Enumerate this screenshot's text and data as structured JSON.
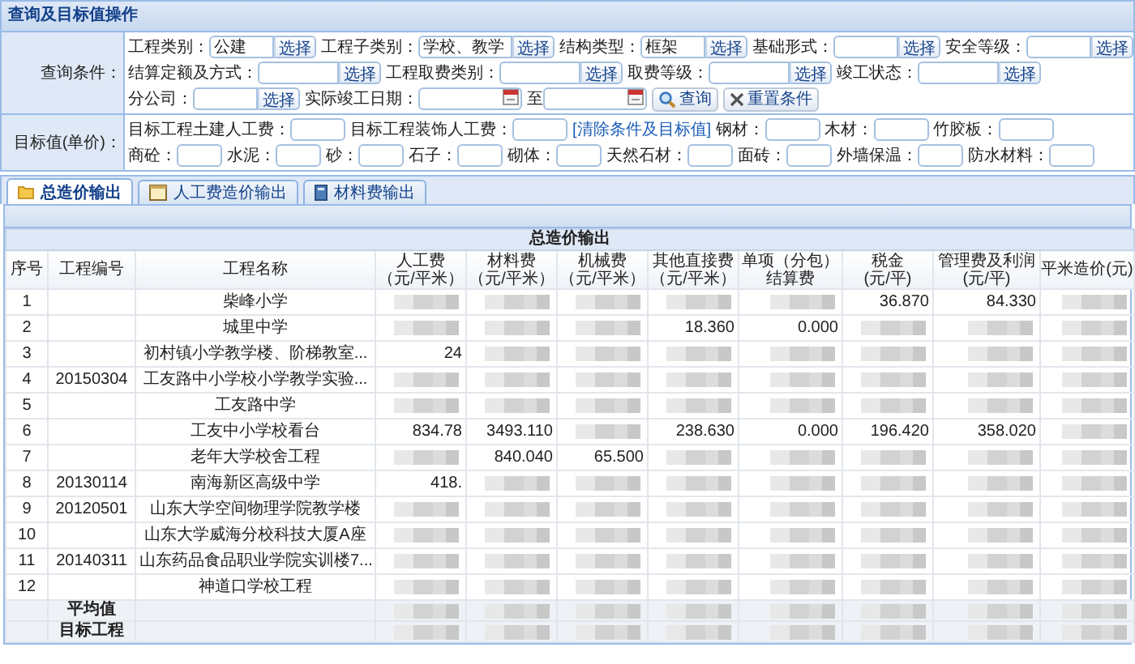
{
  "panel": {
    "title": "查询及目标值操作"
  },
  "query": {
    "label": "查询条件：",
    "rows": [
      {
        "fields": [
          {
            "kind": "select",
            "label": "工程类别：",
            "value": "公建",
            "button": "选择"
          },
          {
            "kind": "select",
            "label": "工程子类别：",
            "value": "学校、教学",
            "button": "选择"
          },
          {
            "kind": "select",
            "label": "结构类型：",
            "value": "框架",
            "button": "选择"
          },
          {
            "kind": "select",
            "label": "基础形式：",
            "button": "选择"
          },
          {
            "kind": "select",
            "label": "安全等级：",
            "button": "选择"
          }
        ]
      },
      {
        "fields": [
          {
            "kind": "select",
            "label": "结算定额及方式：",
            "button": "选择"
          },
          {
            "kind": "select",
            "label": "工程取费类别：",
            "button": "选择"
          },
          {
            "kind": "select",
            "label": "取费等级：",
            "button": "选择"
          },
          {
            "kind": "select",
            "label": "竣工状态：",
            "button": "选择"
          }
        ]
      },
      {
        "fields": [
          {
            "kind": "select",
            "label": "分公司：",
            "button": "选择"
          },
          {
            "kind": "date",
            "label": "实际竣工日期："
          },
          {
            "kind": "date",
            "label": "至"
          },
          {
            "kind": "search",
            "button": "查询"
          },
          {
            "kind": "reset",
            "button": "重置条件"
          }
        ]
      }
    ]
  },
  "targets": {
    "label": "目标值(单价)：",
    "rows": [
      {
        "fields": [
          {
            "kind": "text",
            "label": "目标工程土建人工费："
          },
          {
            "kind": "text",
            "label": "目标工程装饰人工费："
          },
          {
            "kind": "link",
            "button": "[清除条件及目标值]"
          },
          {
            "kind": "text",
            "label": "钢材："
          },
          {
            "kind": "text",
            "label": "木材："
          },
          {
            "kind": "text",
            "label": "竹胶板："
          }
        ]
      },
      {
        "fields": [
          {
            "kind": "text",
            "label": "商砼："
          },
          {
            "kind": "text",
            "label": "水泥："
          },
          {
            "kind": "text",
            "label": "砂："
          },
          {
            "kind": "text",
            "label": "石子："
          },
          {
            "kind": "text",
            "label": "砌体："
          },
          {
            "kind": "text",
            "label": "天然石材："
          },
          {
            "kind": "text",
            "label": "面砖："
          },
          {
            "kind": "text",
            "label": "外墙保温："
          },
          {
            "kind": "text",
            "label": "防水材料："
          }
        ]
      }
    ]
  },
  "tabs": [
    {
      "label": "总造价输出",
      "selected": true
    },
    {
      "label": "人工费造价输出",
      "selected": false
    },
    {
      "label": "材料费输出",
      "selected": false
    }
  ],
  "table": {
    "caption": "总造价输出",
    "columns": [
      {
        "lines": [
          "序号"
        ]
      },
      {
        "lines": [
          "工程编号"
        ]
      },
      {
        "lines": [
          "工程名称"
        ]
      },
      {
        "lines": [
          "人工费",
          "（元/平米）"
        ]
      },
      {
        "lines": [
          "材料费",
          "（元/平米）"
        ]
      },
      {
        "lines": [
          "机械费",
          "（元/平米）"
        ]
      },
      {
        "lines": [
          "其他直接费",
          "（元/平米）"
        ]
      },
      {
        "lines": [
          "单项（分包）",
          "结算费"
        ]
      },
      {
        "lines": [
          "税金",
          "(元/平)"
        ]
      },
      {
        "lines": [
          "管理费及利润",
          "(元/平)"
        ]
      },
      {
        "lines": [
          "平米造价(元)"
        ]
      }
    ],
    "rows": [
      {
        "cells": [
          {
            "text": "1"
          },
          {
            "text": ""
          },
          {
            "text": "柴峰小学"
          },
          {
            "blurred": true
          },
          {
            "blurred": true
          },
          {
            "blurred": true
          },
          {
            "blurred": true
          },
          {
            "blurred": true
          },
          {
            "text": "36.870"
          },
          {
            "text": "84.330"
          },
          {
            "blurred": true
          }
        ]
      },
      {
        "cells": [
          {
            "text": "2"
          },
          {
            "text": ""
          },
          {
            "text": "城里中学"
          },
          {
            "blurred": true
          },
          {
            "blurred": true
          },
          {
            "blurred": true
          },
          {
            "text": "18.360"
          },
          {
            "text": "0.000"
          },
          {
            "blurred": true
          },
          {
            "blurred": true
          },
          {
            "blurred": true
          }
        ]
      },
      {
        "cells": [
          {
            "text": "3"
          },
          {
            "text": ""
          },
          {
            "text": "初村镇小学教学楼、阶梯教室..."
          },
          {
            "text": "24"
          },
          {
            "blurred": true
          },
          {
            "blurred": true
          },
          {
            "blurred": true
          },
          {
            "blurred": true
          },
          {
            "blurred": true
          },
          {
            "blurred": true
          },
          {
            "blurred": true
          }
        ]
      },
      {
        "cells": [
          {
            "text": "4"
          },
          {
            "text": "20150304"
          },
          {
            "text": "工友路中小学校小学教学实验..."
          },
          {
            "blurred": true
          },
          {
            "blurred": true
          },
          {
            "blurred": true
          },
          {
            "blurred": true
          },
          {
            "blurred": true
          },
          {
            "blurred": true
          },
          {
            "blurred": true
          },
          {
            "blurred": true
          }
        ]
      },
      {
        "cells": [
          {
            "text": "5"
          },
          {
            "text": ""
          },
          {
            "text": "工友路中学"
          },
          {
            "blurred": true
          },
          {
            "blurred": true
          },
          {
            "blurred": true
          },
          {
            "blurred": true
          },
          {
            "blurred": true
          },
          {
            "blurred": true
          },
          {
            "blurred": true
          },
          {
            "blurred": true
          }
        ]
      },
      {
        "cells": [
          {
            "text": "6"
          },
          {
            "text": ""
          },
          {
            "text": "工友中小学校看台"
          },
          {
            "text": "834.78"
          },
          {
            "text": "3493.110"
          },
          {
            "blurred": true
          },
          {
            "text": "238.630"
          },
          {
            "text": "0.000"
          },
          {
            "text": "196.420"
          },
          {
            "text": "358.020"
          },
          {
            "blurred": true
          }
        ]
      },
      {
        "cells": [
          {
            "text": "7"
          },
          {
            "text": ""
          },
          {
            "text": "老年大学校舍工程"
          },
          {
            "blurred": true
          },
          {
            "text": "840.040"
          },
          {
            "text": "65.500"
          },
          {
            "blurred": true
          },
          {
            "blurred": true
          },
          {
            "blurred": true
          },
          {
            "blurred": true
          },
          {
            "blurred": true
          }
        ]
      },
      {
        "cells": [
          {
            "text": "8"
          },
          {
            "text": "20130114"
          },
          {
            "text": "南海新区高级中学"
          },
          {
            "text": "418."
          },
          {
            "blurred": true
          },
          {
            "blurred": true
          },
          {
            "blurred": true
          },
          {
            "blurred": true
          },
          {
            "blurred": true
          },
          {
            "blurred": true
          },
          {
            "blurred": true
          }
        ]
      },
      {
        "cells": [
          {
            "text": "9"
          },
          {
            "text": "20120501"
          },
          {
            "text": "山东大学空间物理学院教学楼"
          },
          {
            "blurred": true
          },
          {
            "blurred": true
          },
          {
            "blurred": true
          },
          {
            "blurred": true
          },
          {
            "blurred": true
          },
          {
            "blurred": true
          },
          {
            "blurred": true
          },
          {
            "blurred": true
          }
        ]
      },
      {
        "cells": [
          {
            "text": "10"
          },
          {
            "text": ""
          },
          {
            "text": "山东大学威海分校科技大厦A座"
          },
          {
            "blurred": true
          },
          {
            "blurred": true
          },
          {
            "blurred": true
          },
          {
            "blurred": true
          },
          {
            "blurred": true
          },
          {
            "blurred": true
          },
          {
            "blurred": true
          },
          {
            "blurred": true
          }
        ]
      },
      {
        "cells": [
          {
            "text": "11"
          },
          {
            "text": "20140311"
          },
          {
            "text": "山东药品食品职业学院实训楼7..."
          },
          {
            "blurred": true
          },
          {
            "blurred": true
          },
          {
            "blurred": true
          },
          {
            "blurred": true
          },
          {
            "blurred": true
          },
          {
            "blurred": true
          },
          {
            "blurred": true
          },
          {
            "blurred": true
          }
        ]
      },
      {
        "cells": [
          {
            "text": "12"
          },
          {
            "text": ""
          },
          {
            "text": "神道口学校工程"
          },
          {
            "blurred": true
          },
          {
            "blurred": true
          },
          {
            "blurred": true
          },
          {
            "blurred": true
          },
          {
            "blurred": true
          },
          {
            "blurred": true
          },
          {
            "blurred": true
          },
          {
            "blurred": true
          }
        ]
      }
    ],
    "footer": [
      {
        "cells": [
          {
            "text": ""
          },
          {
            "text": "平均值"
          },
          {
            "text": ""
          },
          {
            "blurred": true
          },
          {
            "blurred": true
          },
          {
            "blurred": true
          },
          {
            "blurred": true
          },
          {
            "blurred": true
          },
          {
            "blurred": true
          },
          {
            "blurred": true
          },
          {
            "blurred": true
          }
        ]
      },
      {
        "cells": [
          {
            "text": ""
          },
          {
            "text": "目标工程"
          },
          {
            "text": ""
          },
          {
            "blurred": true
          },
          {
            "blurred": true
          },
          {
            "blurred": true
          },
          {
            "blurred": true
          },
          {
            "blurred": true
          },
          {
            "blurred": true
          },
          {
            "blurred": true
          },
          {
            "blurred": true
          }
        ]
      }
    ]
  }
}
